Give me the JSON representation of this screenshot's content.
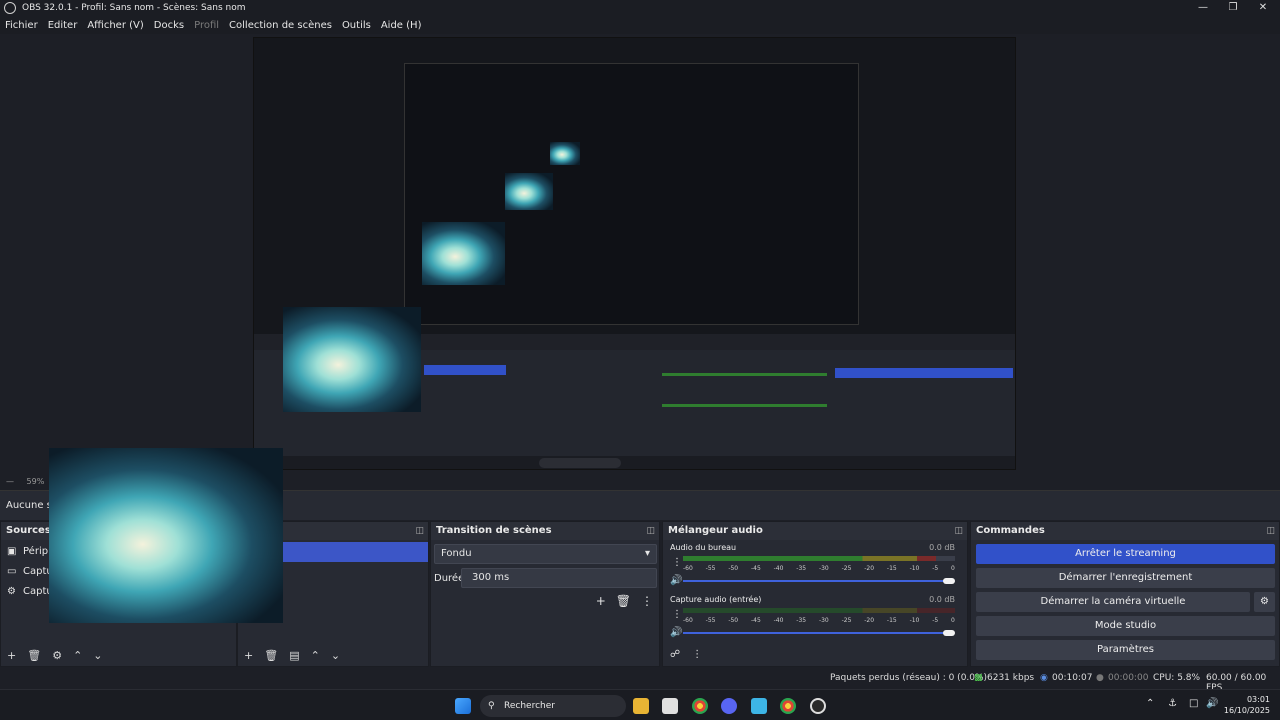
{
  "window": {
    "title": "OBS 32.0.1 - Profil: Sans nom - Scènes: Sans nom",
    "controls": [
      "minimize-icon",
      "maximize-icon",
      "close-icon"
    ]
  },
  "menu": [
    {
      "label": "Fichier",
      "disabled": false
    },
    {
      "label": "Editer",
      "disabled": false
    },
    {
      "label": "Afficher (V)",
      "disabled": false
    },
    {
      "label": "Docks",
      "disabled": false
    },
    {
      "label": "Profil",
      "disabled": true
    },
    {
      "label": "Collection de scènes",
      "disabled": false
    },
    {
      "label": "Outils",
      "disabled": false
    },
    {
      "label": "Aide (H)",
      "disabled": false
    }
  ],
  "zoom": "59%",
  "no_source": "Aucune source sélectionnée",
  "sources": {
    "title": "Sources",
    "items": [
      {
        "label": "Périphérique de capture vidéo",
        "icon": "camera-icon"
      },
      {
        "label": "Capture d'écran",
        "icon": "monitor-icon"
      },
      {
        "label": "Capture audio (entrée)",
        "icon": "microphone-icon"
      }
    ]
  },
  "transition": {
    "title": "Transition de scènes",
    "selected": "Fondu",
    "duration_label": "Durée",
    "duration_value": "300 ms"
  },
  "mixer": {
    "title": "Mélangeur audio",
    "channels": [
      {
        "name": "Audio du bureau",
        "db": "0.0 dB",
        "level": 0.93
      },
      {
        "name": "Capture audio (entrée)",
        "db": "0.0 dB",
        "level": 0.0
      }
    ],
    "scale": [
      "-60",
      "-55",
      "-50",
      "-45",
      "-40",
      "-35",
      "-30",
      "-25",
      "-20",
      "-15",
      "-10",
      "-5",
      "0"
    ]
  },
  "commands": {
    "title": "Commandes",
    "buttons": [
      {
        "label": "Arrêter le streaming",
        "active": true
      },
      {
        "label": "Démarrer l'enregistrement",
        "active": false
      },
      {
        "label": "Démarrer la caméra virtuelle",
        "active": false
      },
      {
        "label": "Mode studio",
        "active": false
      },
      {
        "label": "Paramètres",
        "active": false
      }
    ]
  },
  "status": {
    "dropped": "Paquets perdus (réseau) : 0 (0.0%)",
    "bitrate": "6231 kbps",
    "stream_time": "00:10:07",
    "rec_time": "00:00:00",
    "cpu": "CPU: 5.8%",
    "fps": "60.00 / 60.00 FPS"
  },
  "taskbar": {
    "search": "Rechercher",
    "time": "03:01",
    "date": "16/10/2025"
  },
  "colors": {
    "accent": "#3151c9",
    "panel": "#272a33",
    "background": "#1d1f26"
  }
}
